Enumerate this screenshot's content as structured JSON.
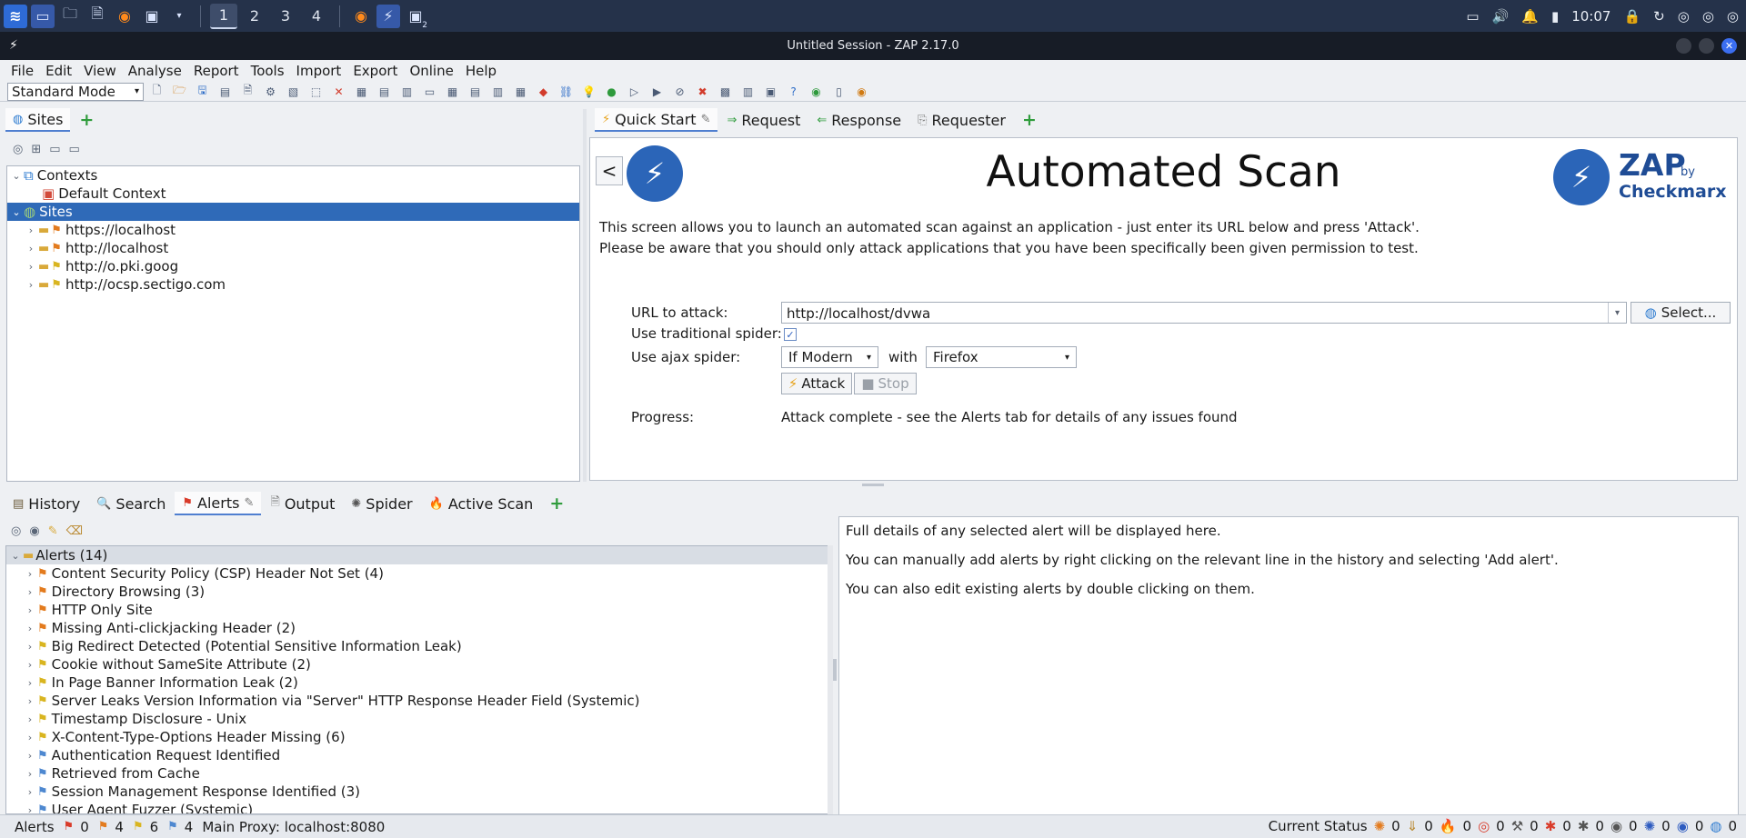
{
  "taskbar": {
    "workspaces": [
      "1",
      "2",
      "3",
      "4"
    ],
    "active_workspace": "1",
    "clock": "10:07",
    "terminal_badge": "2"
  },
  "window": {
    "title": "Untitled Session - ZAP 2.17.0"
  },
  "menu": [
    "File",
    "Edit",
    "View",
    "Analyse",
    "Report",
    "Tools",
    "Import",
    "Export",
    "Online",
    "Help"
  ],
  "toolbar": {
    "mode": "Standard Mode"
  },
  "sites_panel": {
    "tab_label": "Sites",
    "contexts_label": "Contexts",
    "default_context": "Default Context",
    "sites_label": "Sites",
    "sites": [
      "https://localhost",
      "http://localhost",
      "http://o.pki.goog",
      "http://ocsp.sectigo.com"
    ]
  },
  "workspace_tabs": [
    "Quick Start",
    "Request",
    "Response",
    "Requester"
  ],
  "quick_start": {
    "back_label": "<",
    "title": "Automated Scan",
    "brand_zap": "ZAP",
    "brand_by": "by",
    "brand_checkmarx": "Checkmarx",
    "intro": "This screen allows you to launch an automated scan against  an application - just enter its URL below and press 'Attack'.",
    "warning": "Please be aware that you should only attack applications that you have been specifically been given permission to test.",
    "url_label": "URL to attack:",
    "url_value": "http://localhost/dvwa",
    "select_label": "Select...",
    "traditional_spider_label": "Use traditional spider:",
    "traditional_spider_checked": true,
    "ajax_spider_label": "Use ajax spider:",
    "ajax_spider_value": "If Modern",
    "with_label": "with",
    "browser_value": "Firefox",
    "attack_label": "Attack",
    "stop_label": "Stop",
    "progress_label": "Progress:",
    "progress_value": "Attack complete - see the Alerts tab for details of any issues found"
  },
  "bottom_tabs": [
    "History",
    "Search",
    "Alerts",
    "Output",
    "Spider",
    "Active Scan"
  ],
  "alerts": {
    "root_label": "Alerts (14)",
    "items": [
      {
        "label": "Content Security Policy (CSP) Header Not Set (4)",
        "risk": "orange"
      },
      {
        "label": "Directory Browsing (3)",
        "risk": "orange"
      },
      {
        "label": "HTTP Only Site",
        "risk": "orange"
      },
      {
        "label": "Missing Anti-clickjacking Header (2)",
        "risk": "orange"
      },
      {
        "label": "Big Redirect Detected (Potential Sensitive Information Leak)",
        "risk": "yellow"
      },
      {
        "label": "Cookie without SameSite Attribute (2)",
        "risk": "yellow"
      },
      {
        "label": "In Page Banner Information Leak (2)",
        "risk": "yellow"
      },
      {
        "label": "Server Leaks Version Information via \"Server\" HTTP Response Header Field (Systemic)",
        "risk": "yellow"
      },
      {
        "label": "Timestamp Disclosure - Unix",
        "risk": "yellow"
      },
      {
        "label": "X-Content-Type-Options Header Missing (6)",
        "risk": "yellow"
      },
      {
        "label": "Authentication Request Identified",
        "risk": "blue"
      },
      {
        "label": "Retrieved from Cache",
        "risk": "blue"
      },
      {
        "label": "Session Management Response Identified (3)",
        "risk": "blue"
      },
      {
        "label": "User Agent Fuzzer (Systemic)",
        "risk": "blue"
      }
    ]
  },
  "alert_detail": [
    "Full details of any selected alert will be displayed here.",
    "You can manually add alerts by right clicking on the relevant line in the history and selecting 'Add alert'.",
    "You can also edit existing alerts by double clicking on them."
  ],
  "status": {
    "alerts_label": "Alerts",
    "high": "0",
    "medium": "4",
    "low": "6",
    "info": "4",
    "proxy": "Main Proxy: localhost:8080",
    "current_status_label": "Current Status",
    "counters": [
      "0",
      "0",
      "0",
      "0",
      "0",
      "0",
      "0",
      "0",
      "0",
      "0",
      "0",
      "0"
    ]
  },
  "colors": {
    "accent": "#2f6ab8",
    "taskbar": "#25324a",
    "high": "#d93b2a",
    "medium": "#e37b1e",
    "low": "#d9b520",
    "info": "#4e88d0"
  }
}
